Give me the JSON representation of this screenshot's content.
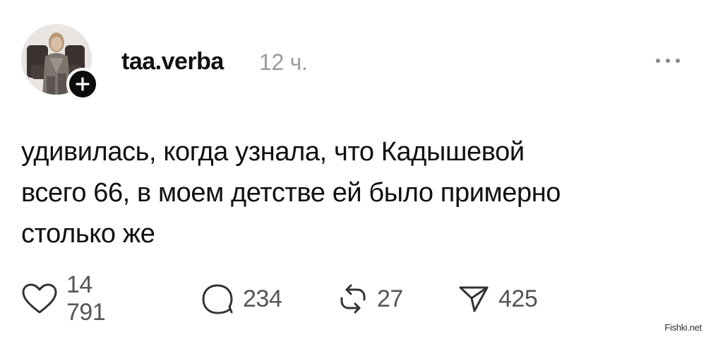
{
  "post": {
    "username": "taa.verba",
    "timestamp": "12 ч.",
    "text_lines": [
      "удивилась, когда узнала, что Кадышевой",
      "всего 66, в моем детстве ей было примерно",
      "столько же"
    ]
  },
  "actions": {
    "likes": "14 791",
    "comments": "234",
    "reposts": "27",
    "shares": "425"
  },
  "icons": {
    "follow": "plus-icon",
    "more": "more-dots-icon",
    "like": "heart-icon",
    "comment": "speech-bubble-icon",
    "repost": "repost-arrows-icon",
    "share": "paper-plane-icon"
  },
  "colors": {
    "text": "#111111",
    "muted": "#9a9a9a",
    "count": "#555555",
    "badge": "#0c0c0c"
  },
  "watermark": "Fishki.net"
}
